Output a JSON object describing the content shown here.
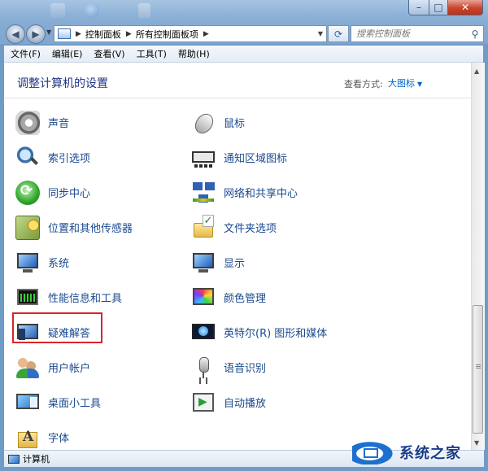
{
  "menubar": {
    "items": [
      "文件(F)",
      "编辑(E)",
      "查看(V)",
      "工具(T)",
      "帮助(H)"
    ]
  },
  "address": {
    "crumbs": [
      "控制面板",
      "所有控制面板项"
    ]
  },
  "search": {
    "placeholder": "搜索控制面板"
  },
  "content": {
    "title": "调整计算机的设置",
    "view_by_label": "查看方式:",
    "view_by_value": "大图标"
  },
  "items": [
    {
      "label": "声音",
      "icon": "speaker-icon"
    },
    {
      "label": "鼠标",
      "icon": "mouse-icon"
    },
    {
      "label": "索引选项",
      "icon": "magnifier-icon"
    },
    {
      "label": "通知区域图标",
      "icon": "notification-tray-icon"
    },
    {
      "label": "同步中心",
      "icon": "sync-icon"
    },
    {
      "label": "网络和共享中心",
      "icon": "network-icon"
    },
    {
      "label": "位置和其他传感器",
      "icon": "sensor-icon"
    },
    {
      "label": "文件夹选项",
      "icon": "folder-options-icon"
    },
    {
      "label": "系统",
      "icon": "system-monitor-icon"
    },
    {
      "label": "显示",
      "icon": "display-monitor-icon"
    },
    {
      "label": "性能信息和工具",
      "icon": "performance-icon"
    },
    {
      "label": "颜色管理",
      "icon": "color-management-icon"
    },
    {
      "label": "疑难解答",
      "icon": "troubleshooting-icon"
    },
    {
      "label": "英特尔(R) 图形和媒体",
      "icon": "intel-graphics-icon"
    },
    {
      "label": "用户帐户",
      "icon": "user-accounts-icon"
    },
    {
      "label": "语音识别",
      "icon": "microphone-icon"
    },
    {
      "label": "桌面小工具",
      "icon": "gadgets-icon"
    },
    {
      "label": "自动播放",
      "icon": "autoplay-icon"
    },
    {
      "label": "字体",
      "icon": "fonts-folder-icon"
    }
  ],
  "highlight": {
    "item": "疑难解答",
    "color": "#d9262a"
  },
  "statusbar": {
    "text": "计算机"
  },
  "watermark": {
    "text": "系统之家"
  }
}
